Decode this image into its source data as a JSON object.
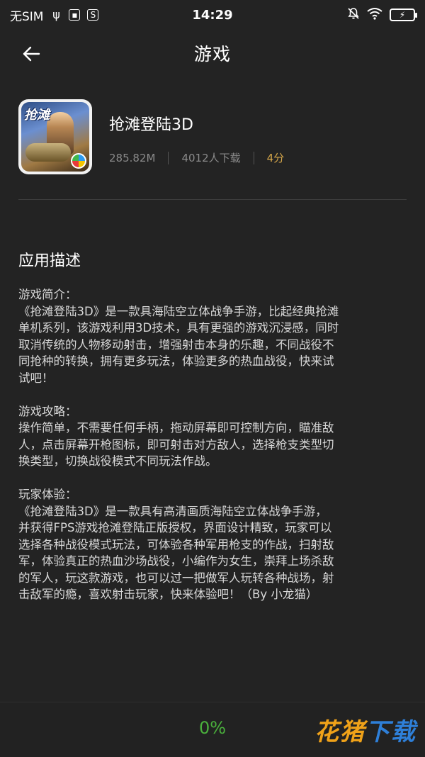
{
  "status_bar": {
    "carrier": "无SIM",
    "time": "14:29",
    "icons": [
      "usb-icon",
      "image-icon",
      "s-icon",
      "mute-icon",
      "wifi-icon",
      "battery-icon"
    ]
  },
  "app_bar": {
    "title": "游戏"
  },
  "app": {
    "name": "抢滩登陆3D",
    "size": "285.82M",
    "downloads": "4012人下载",
    "rating": "4分",
    "icon_text": "抢滩"
  },
  "description": {
    "title": "应用描述",
    "blocks": [
      {
        "lines": [
          "游戏简介：",
          "《抢滩登陆3D》是一款具海陆空立体战争手游，比起经典抢滩",
          "单机系列，该游戏利用3D技术，具有更强的游戏沉浸感，同时",
          "取消传统的人物移动射击，增强射击本身的乐趣，不同战役不",
          "同抢种的转换，拥有更多玩法，体验更多的热血战役，快来试",
          "试吧！"
        ]
      },
      {
        "lines": [
          "游戏攻略：",
          "操作简单，不需要任何手柄，拖动屏幕即可控制方向，瞄准敌",
          "人，点击屏幕开枪图标，即可射击对方敌人，选择枪支类型切",
          "换类型，切换战役模式不同玩法作战。"
        ]
      },
      {
        "lines": [
          "玩家体验：",
          "《抢滩登陆3D》是一款具有高清画质海陆空立体战争手游，",
          "并获得FPS游戏抢滩登陆正版授权，界面设计精致，玩家可以",
          "选择各种战役模式玩法，可体验各种军用枪支的作战，扫射敌",
          "军，体验真正的热血沙场战役，小编作为女生，崇拜上场杀敌",
          "的军人，玩这款游戏，也可以过一把做军人玩转各种战场，射",
          "击敌军的瘾，喜欢射击玩家，快来体验吧！（By 小龙猫）"
        ]
      }
    ]
  },
  "download": {
    "progress_label": "0%"
  },
  "watermark": {
    "chars": [
      "花",
      "猪",
      "下",
      "载"
    ]
  },
  "colors": {
    "background": "#232323",
    "progress": "#4ab03c",
    "rating": "#d4a64a"
  }
}
